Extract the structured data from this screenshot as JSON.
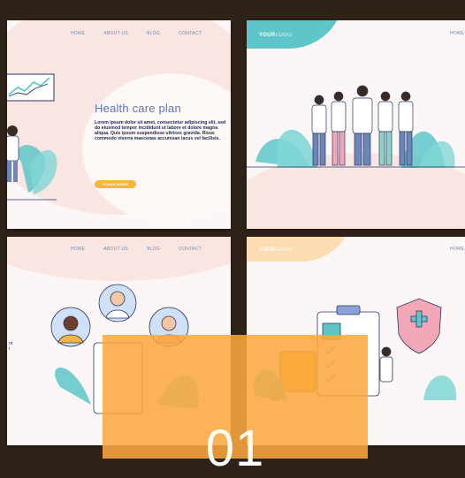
{
  "panels": {
    "p1": {
      "nav": [
        "HOME",
        "ABOUT US",
        "BLOG",
        "CONTACT"
      ],
      "title": "Health care plan",
      "paragraph": "Lorem ipsum dolor sit amet, consectetur adipiscing elit, sed do eiusmod tempor incididunt ut labore et dolore magna aliqua. Quis ipsum suspendisse ultrices gravida. Risus commodo viverra maecenas accumsan lacus vel facilisis.",
      "button": "LEARN MORE"
    },
    "p2": {
      "logo_bold": "YOUR",
      "logo_light": "LOGO",
      "nav": [
        "HOME"
      ]
    },
    "p3": {
      "nav": [
        "HOME",
        "ABOUT US",
        "BLOG",
        "CONTACT"
      ]
    },
    "p4": {
      "logo_bold": "YOUR",
      "logo_light": "LOGO",
      "nav": [
        "HOME"
      ]
    }
  },
  "overlay": {
    "number": "01",
    "color": "#fca83e"
  },
  "colors": {
    "accent_blue": "#5b77b6",
    "teal": "#5ec6c8",
    "pink_bg": "#f9e1dc",
    "orange": "#f5b53e"
  }
}
